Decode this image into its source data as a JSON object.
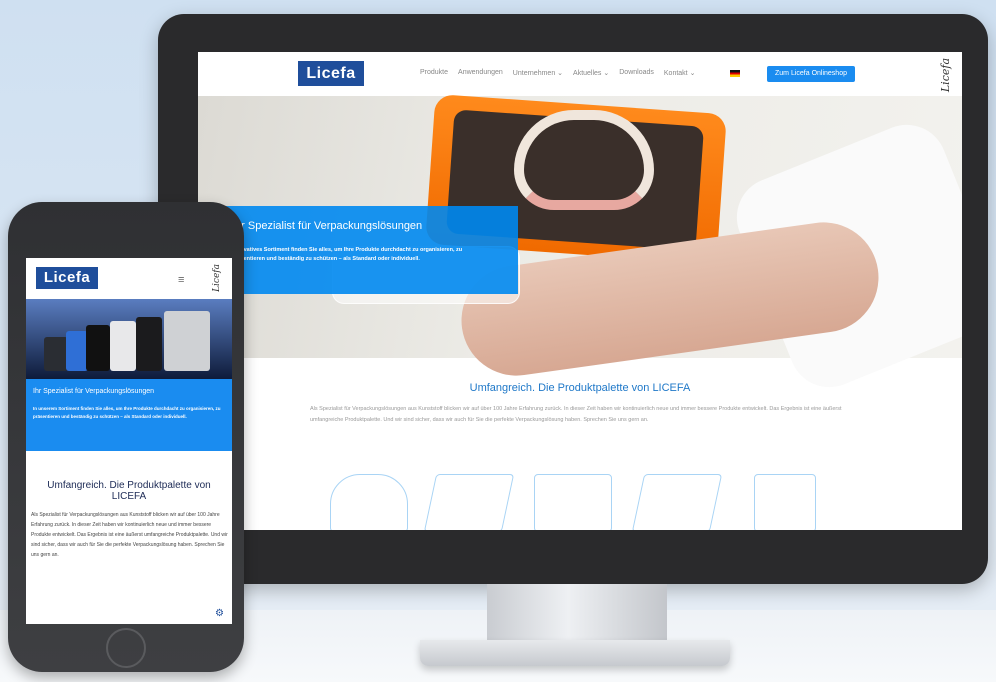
{
  "brand": {
    "logo_text": "Licefa",
    "signature": "Licefa"
  },
  "desktop": {
    "nav": {
      "items": [
        "Produkte",
        "Anwendungen",
        "Unternehmen ⌄",
        "Aktuelles ⌄",
        "Downloads",
        "Kontakt ⌄"
      ],
      "cta_label": "Zum Licefa Onlineshop"
    },
    "hero": {
      "title": "Ihr Spezialist für Verpackungslösungen",
      "text": "Innovatives Sortiment finden Sie alles, um Ihre Produkte durchdacht zu organisieren, zu präsentieren und beständig zu schützen – als Standard oder individuell."
    },
    "section": {
      "title": "Umfangreich. Die Produktpalette von LICEFA",
      "text": "Als Spezialist für Verpackungslösungen aus Kunststoff blicken wir auf über 100 Jahre Erfahrung zurück. In dieser Zeit haben wir kontinuierlich neue und immer bessere Produkte entwickelt. Das Ergebnis ist eine äußerst umfangreiche Produktpalette. Und wir sind sicher, dass wir auch für Sie die perfekte Verpackungslösung haben. Sprechen Sie uns gern an."
    }
  },
  "mobile": {
    "menu_icon": "≡",
    "hero": {
      "title": "Ihr Spezialist für Verpackungslösungen",
      "text": "In unserem Sortiment finden Sie alles, um Ihre Produkte durchdacht zu organisieren, zu präsentieren und beständig zu schützen – als Standard oder individuell."
    },
    "section": {
      "title": "Umfangreich. Die Produktpalette von LICEFA",
      "text": "Als Spezialist für Verpackungslösungen aus Kunststoff blicken wir auf über 100 Jahre Erfahrung zurück. In dieser Zeit haben wir kontinuierlich neue und immer bessere Produkte entwickelt. Das Ergebnis ist eine äußerst umfangreiche Produktpalette. Und wir sind sicher, dass wir auch für Sie die perfekte Verpackungslösung haben. Sprechen Sie uns gern an."
    },
    "settings_icon": "⚙"
  },
  "colors": {
    "accent": "#1a8cf0",
    "brand": "#1f4e9b",
    "orange": "#f07800"
  }
}
